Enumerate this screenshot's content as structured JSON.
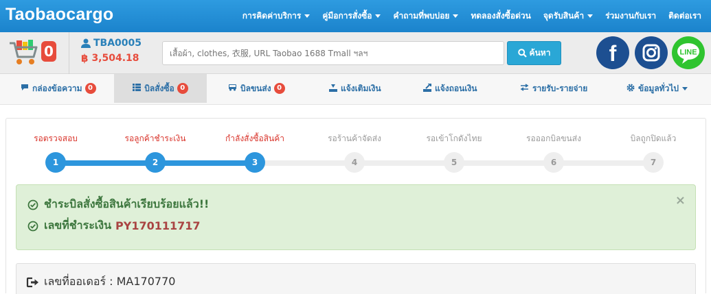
{
  "brand": {
    "logo": "Taobaocargo"
  },
  "topnav": [
    {
      "label": "การคิดค่าบริการ",
      "dropdown": true
    },
    {
      "label": "คู่มือการสั่งซื้อ",
      "dropdown": true
    },
    {
      "label": "คำถามที่พบบ่อย",
      "dropdown": true
    },
    {
      "label": "ทดลองสั่งซื้อด่วน",
      "dropdown": false
    },
    {
      "label": "จุดรับสินค้า",
      "dropdown": true
    },
    {
      "label": "ร่วมงานกับเรา",
      "dropdown": false
    },
    {
      "label": "ติดต่อเรา",
      "dropdown": false
    }
  ],
  "cart": {
    "count": "0"
  },
  "user": {
    "id": "TBA0005",
    "balance": "3,504.18",
    "currency_symbol": "฿"
  },
  "search": {
    "placeholder": "เสื้อผ้า, clothes, 衣服, URL Taobao 1688 Tmall ฯลฯ",
    "button_label": "ค้นหา"
  },
  "social": [
    {
      "name": "facebook",
      "label": "f",
      "color": "#1d4f91"
    },
    {
      "name": "instagram",
      "color": "#1d4f91"
    },
    {
      "name": "line",
      "label": "LINE",
      "color": "#2fc42f"
    }
  ],
  "tabs": [
    {
      "label": "กล่องข้อความ",
      "badge": "0",
      "icon": "chat-icon"
    },
    {
      "label": "บิลสั่งซื้อ",
      "badge": "0",
      "icon": "list-icon",
      "active": true
    },
    {
      "label": "บิลขนส่ง",
      "badge": "0",
      "icon": "truck-icon"
    },
    {
      "label": "แจ้งเติมเงิน",
      "icon": "deposit-icon"
    },
    {
      "label": "แจ้งถอนเงิน",
      "icon": "withdraw-icon"
    },
    {
      "label": "รายรับ-รายจ่าย",
      "icon": "exchange-icon"
    },
    {
      "label": "ข้อมูลทั่วไป",
      "icon": "gear-icon",
      "dropdown": true
    }
  ],
  "steps": {
    "current": 3,
    "items": [
      {
        "number": "1",
        "label": "รอตรวจสอบ"
      },
      {
        "number": "2",
        "label": "รอลูกค้าชำระเงิน"
      },
      {
        "number": "3",
        "label": "กำลังสั่งซื้อสินค้า"
      },
      {
        "number": "4",
        "label": "รอร้านค้าจัดส่ง"
      },
      {
        "number": "5",
        "label": "รอเข้าโกดังไทย"
      },
      {
        "number": "6",
        "label": "รอออกบิลขนส่ง"
      },
      {
        "number": "7",
        "label": "บิลถูกปิดแล้ว"
      }
    ]
  },
  "alert": {
    "line1": "ชำระบิลสั่งซื้อสินค้าเรียบร้อยแล้ว!!",
    "line2_prefix": "เลขที่ชำระเงิน",
    "payment_no": "PY170111717",
    "close": "×"
  },
  "order": {
    "label": "เลขที่ออเดอร์ : MA170770"
  },
  "colors": {
    "primary": "#2e9be0",
    "step_active": "#2d96dd",
    "step_done_label": "#d9342b",
    "step_inactive": "#eeeeee",
    "alert_bg": "#dff0d8",
    "badge": "#e74c3c"
  }
}
